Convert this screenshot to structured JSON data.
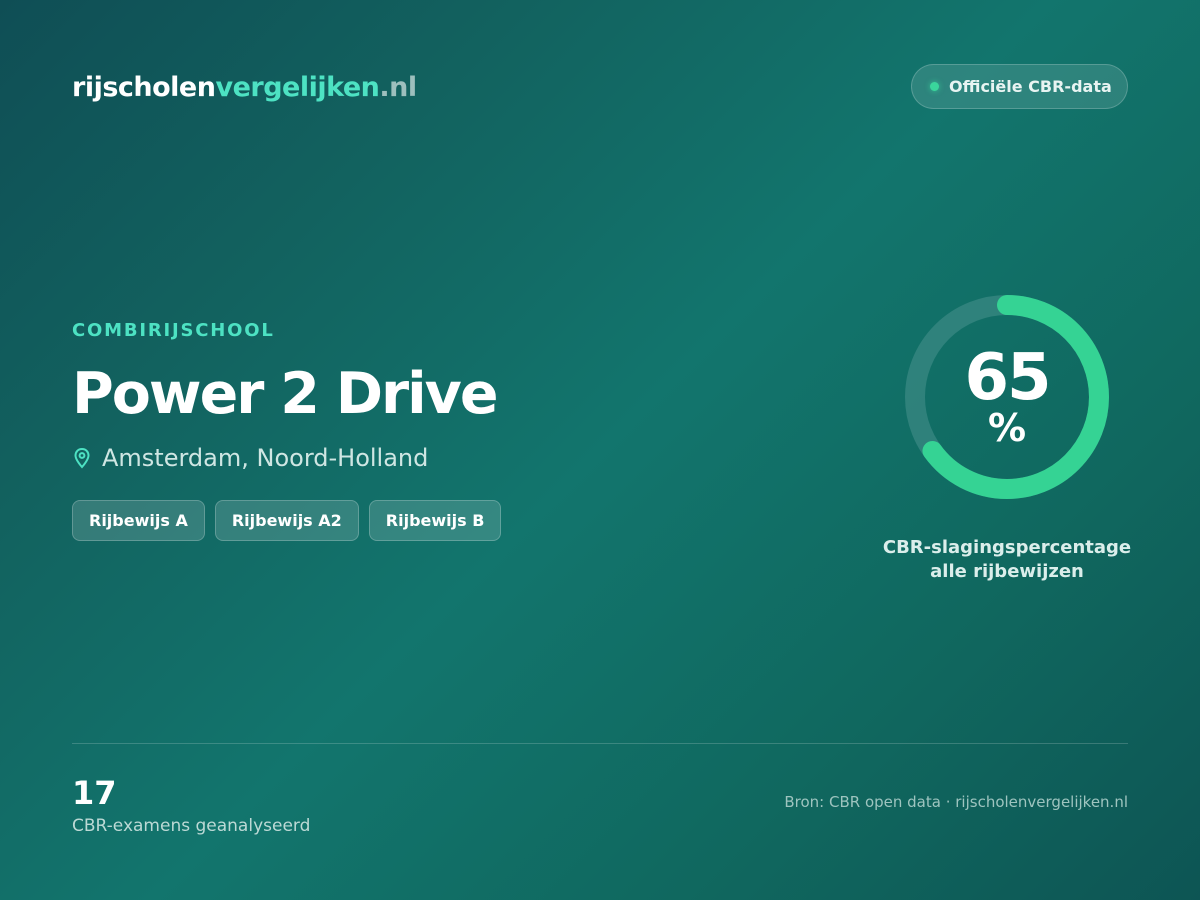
{
  "brand": {
    "part1": "rijscholen",
    "part2": "vergelijken",
    "part3": ".nl"
  },
  "badge": {
    "label": "Officiële CBR-data",
    "icon": "status-dot-icon"
  },
  "school": {
    "category": "COMBIRIJSCHOOL",
    "name": "Power 2 Drive",
    "location": "Amsterdam, Noord-Holland",
    "location_icon": "map-pin-icon",
    "licenses": [
      "Rijbewijs A",
      "Rijbewijs A2",
      "Rijbewijs B"
    ]
  },
  "pass_rate": {
    "value": 65,
    "value_text": "65",
    "unit": "%",
    "caption_line1": "CBR-slagingspercentage",
    "caption_line2": "alle rijbewijzen"
  },
  "footer": {
    "exam_count": "17",
    "exam_label": "CBR-examens geanalyseerd",
    "source": "Bron: CBR open data · rijscholenvergelijken.nl"
  },
  "colors": {
    "accent": "#4de2c3",
    "ring_progress": "#35d394",
    "ring_track": "#3a8883",
    "status_dot": "#3ad69c"
  }
}
